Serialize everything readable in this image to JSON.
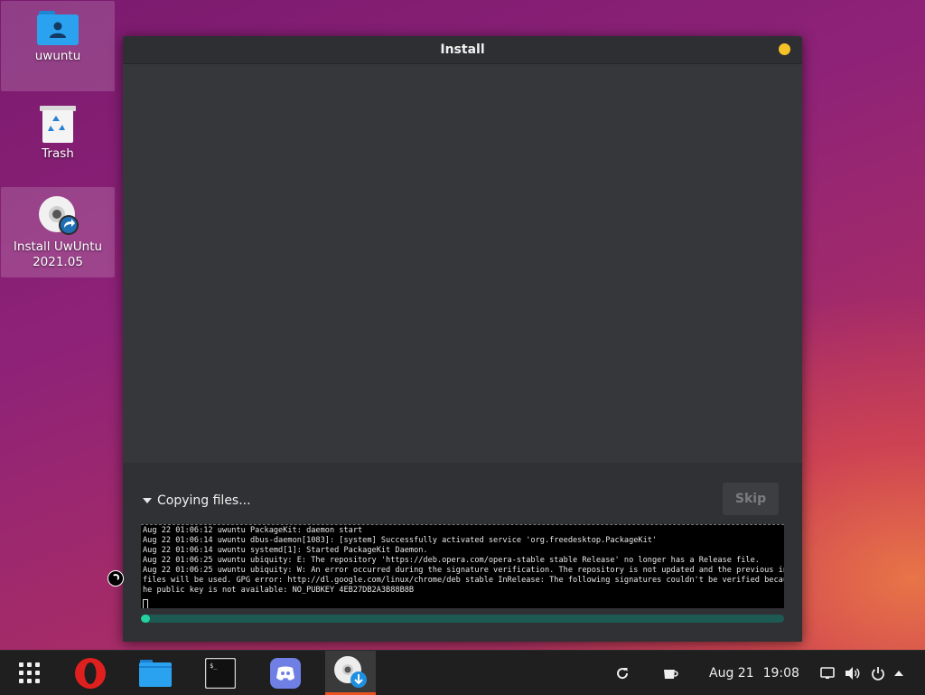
{
  "desktop": {
    "icons": [
      {
        "label": "uwuntu",
        "icon": "home-folder-icon"
      },
      {
        "label": "Trash",
        "icon": "trash-icon"
      },
      {
        "label_line1": "Install UwUntu",
        "label_line2": "2021.05",
        "icon": "installer-disc-icon"
      }
    ]
  },
  "window": {
    "title": "Install",
    "expander_label": "Copying files...",
    "skip_label": "Skip",
    "terminal_lines": [
      "Aug 22 01:06:12 uwuntu PackageKit: daemon start",
      "Aug 22 01:06:14 uwuntu dbus-daemon[1083]: [system] Successfully activated service 'org.freedesktop.PackageKit'",
      "Aug 22 01:06:14 uwuntu systemd[1]: Started PackageKit Daemon.",
      "Aug 22 01:06:25 uwuntu ubiquity: E: The repository 'https://deb.opera.com/opera-stable stable Release' no longer has a Release file.",
      "Aug 22 01:06:25 uwuntu ubiquity: W: An error occurred during the signature verification. The repository is not updated and the previous index",
      "files will be used. GPG error: http://dl.google.com/linux/chrome/deb stable InRelease: The following signatures couldn't be verified because t",
      "he public key is not available: NO_PUBKEY 4EB27DB2A3B88B8B"
    ],
    "progress_fraction": 0.01,
    "colors": {
      "progress_fill": "#26d1a0",
      "progress_track": "#1e5a54",
      "title_dot": "#f5c227"
    }
  },
  "taskbar": {
    "apps": [
      "app-grid-icon",
      "opera-icon",
      "files-icon",
      "terminal-icon",
      "discord-icon",
      "installer-icon"
    ],
    "date": "Aug 21",
    "time": "19:08",
    "tray_icons": [
      "refresh-icon",
      "caffeine-icon",
      "display-icon",
      "volume-icon",
      "power-icon",
      "chevron-up-icon"
    ],
    "accent": "#e95420"
  }
}
